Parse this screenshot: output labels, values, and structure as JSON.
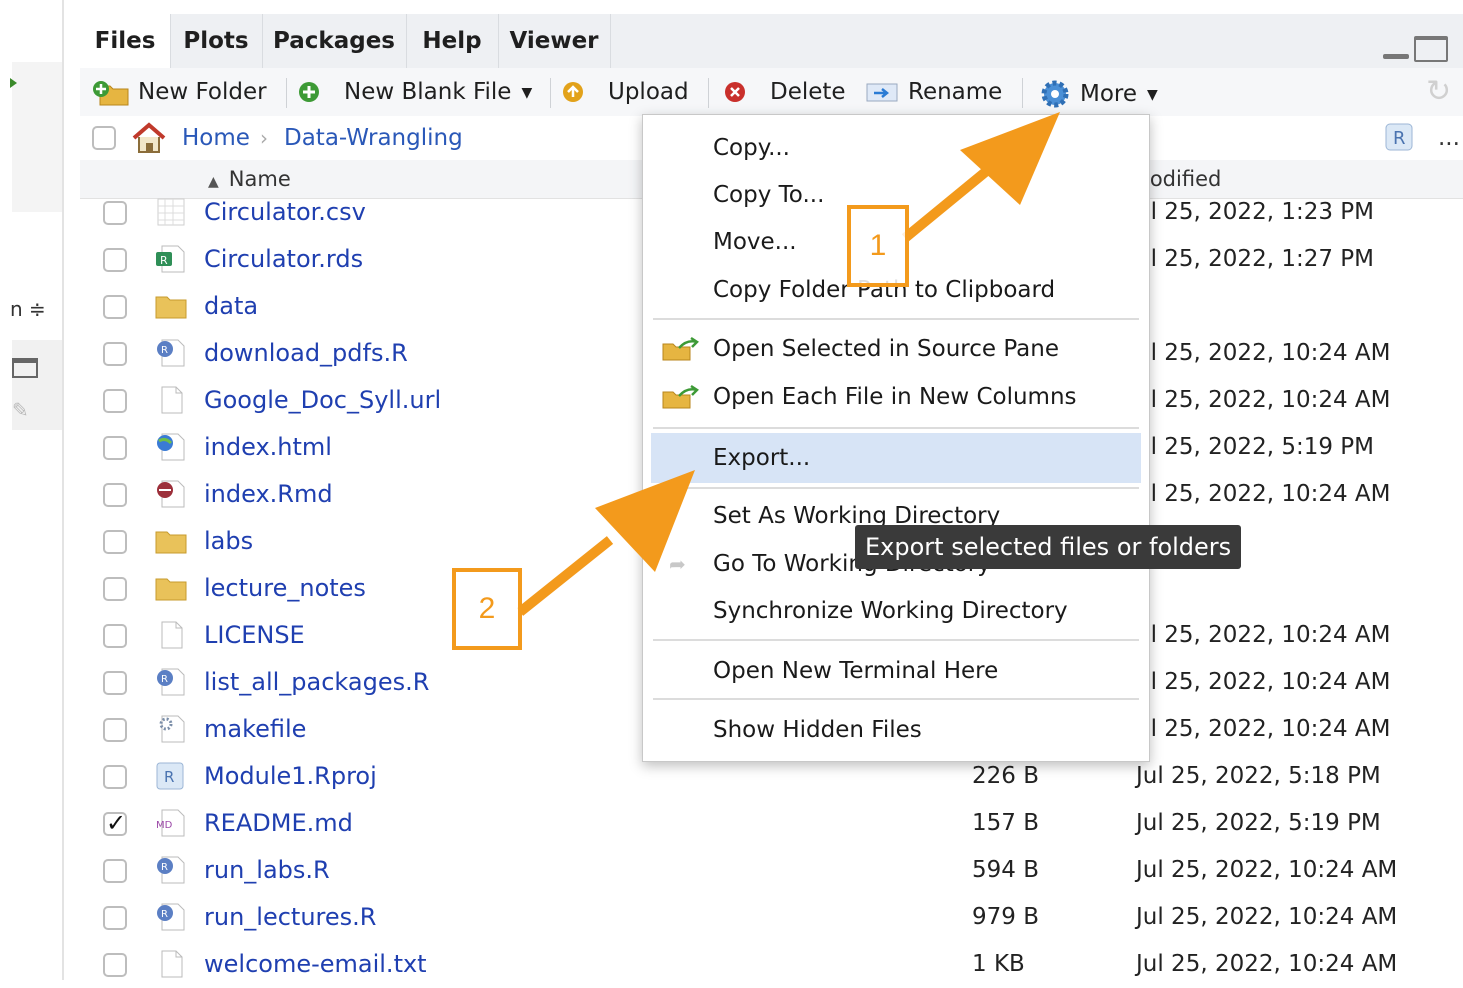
{
  "tabs": [
    {
      "label": "Files",
      "active": true
    },
    {
      "label": "Plots",
      "active": false
    },
    {
      "label": "Packages",
      "active": false
    },
    {
      "label": "Help",
      "active": false
    },
    {
      "label": "Viewer",
      "active": false
    }
  ],
  "toolbar": {
    "new_folder": "New Folder",
    "new_blank_file": "New Blank File",
    "upload": "Upload",
    "delete": "Delete",
    "rename": "Rename",
    "more": "More"
  },
  "breadcrumb": {
    "home": "Home",
    "folder": "Data-Wrangling",
    "overflow": "..."
  },
  "header": {
    "name": "Name",
    "modified": "lodified"
  },
  "left_pane": {
    "sort_label": "n ≑"
  },
  "files": [
    {
      "name": "Circulator.csv",
      "size": "",
      "modified": "ul 25, 2022, 1:23 PM",
      "icon": "csv-file-icon",
      "checked": false
    },
    {
      "name": "Circulator.rds",
      "size": "",
      "modified": "ul 25, 2022, 1:27 PM",
      "icon": "rds-file-icon",
      "checked": false
    },
    {
      "name": "data",
      "size": "",
      "modified": "",
      "icon": "folder-icon",
      "checked": false
    },
    {
      "name": "download_pdfs.R",
      "size": "",
      "modified": "ul 25, 2022, 10:24 AM",
      "icon": "r-script-icon",
      "checked": false
    },
    {
      "name": "Google_Doc_Syll.url",
      "size": "",
      "modified": "ul 25, 2022, 10:24 AM",
      "icon": "blank-file-icon",
      "checked": false
    },
    {
      "name": "index.html",
      "size": "",
      "modified": "ul 25, 2022, 5:19 PM",
      "icon": "html-file-icon",
      "checked": false
    },
    {
      "name": "index.Rmd",
      "size": "",
      "modified": "ul 25, 2022, 10:24 AM",
      "icon": "rmd-file-icon",
      "checked": false
    },
    {
      "name": "labs",
      "size": "",
      "modified": "",
      "icon": "folder-icon",
      "checked": false
    },
    {
      "name": "lecture_notes",
      "size": "",
      "modified": "",
      "icon": "folder-icon",
      "checked": false
    },
    {
      "name": "LICENSE",
      "size": "",
      "modified": "ul 25, 2022, 10:24 AM",
      "icon": "blank-file-icon",
      "checked": false
    },
    {
      "name": "list_all_packages.R",
      "size": "",
      "modified": "ul 25, 2022, 10:24 AM",
      "icon": "r-script-icon",
      "checked": false
    },
    {
      "name": "makefile",
      "size": "",
      "modified": "ul 25, 2022, 10:24 AM",
      "icon": "gear-file-icon",
      "checked": false
    },
    {
      "name": "Module1.Rproj",
      "size": "226 B",
      "modified": "Jul 25, 2022, 5:18 PM",
      "icon": "rproj-file-icon",
      "checked": false
    },
    {
      "name": "README.md",
      "size": "157 B",
      "modified": "Jul 25, 2022, 5:19 PM",
      "icon": "markdown-file-icon",
      "checked": true
    },
    {
      "name": "run_labs.R",
      "size": "594 B",
      "modified": "Jul 25, 2022, 10:24 AM",
      "icon": "r-script-icon",
      "checked": false
    },
    {
      "name": "run_lectures.R",
      "size": "979 B",
      "modified": "Jul 25, 2022, 10:24 AM",
      "icon": "r-script-icon",
      "checked": false
    },
    {
      "name": "welcome-email.txt",
      "size": "1 KB",
      "modified": "Jul 25, 2022, 10:24 AM",
      "icon": "blank-file-icon",
      "checked": false
    }
  ],
  "menu": {
    "copy": "Copy...",
    "copy_to": "Copy To...",
    "move": "Move...",
    "copy_folder_path": "Copy Folder Path to Clipboard",
    "open_in_source": "Open Selected in Source Pane",
    "open_new_columns": "Open Each File in New Columns",
    "export": "Export...",
    "set_working_dir": "Set As Working Directory",
    "go_to_working_dir": "Go To Working Directory",
    "sync_working_dir": "Synchronize Working Directory",
    "open_terminal": "Open New Terminal Here",
    "show_hidden": "Show Hidden Files"
  },
  "tooltip": "Export selected files or folders",
  "annotations": {
    "callout_1": "1",
    "callout_2": "2"
  },
  "colors": {
    "accent_orange": "#f39a1c",
    "link_blue": "#1f3fb0",
    "highlight": "#d7e4f6"
  }
}
